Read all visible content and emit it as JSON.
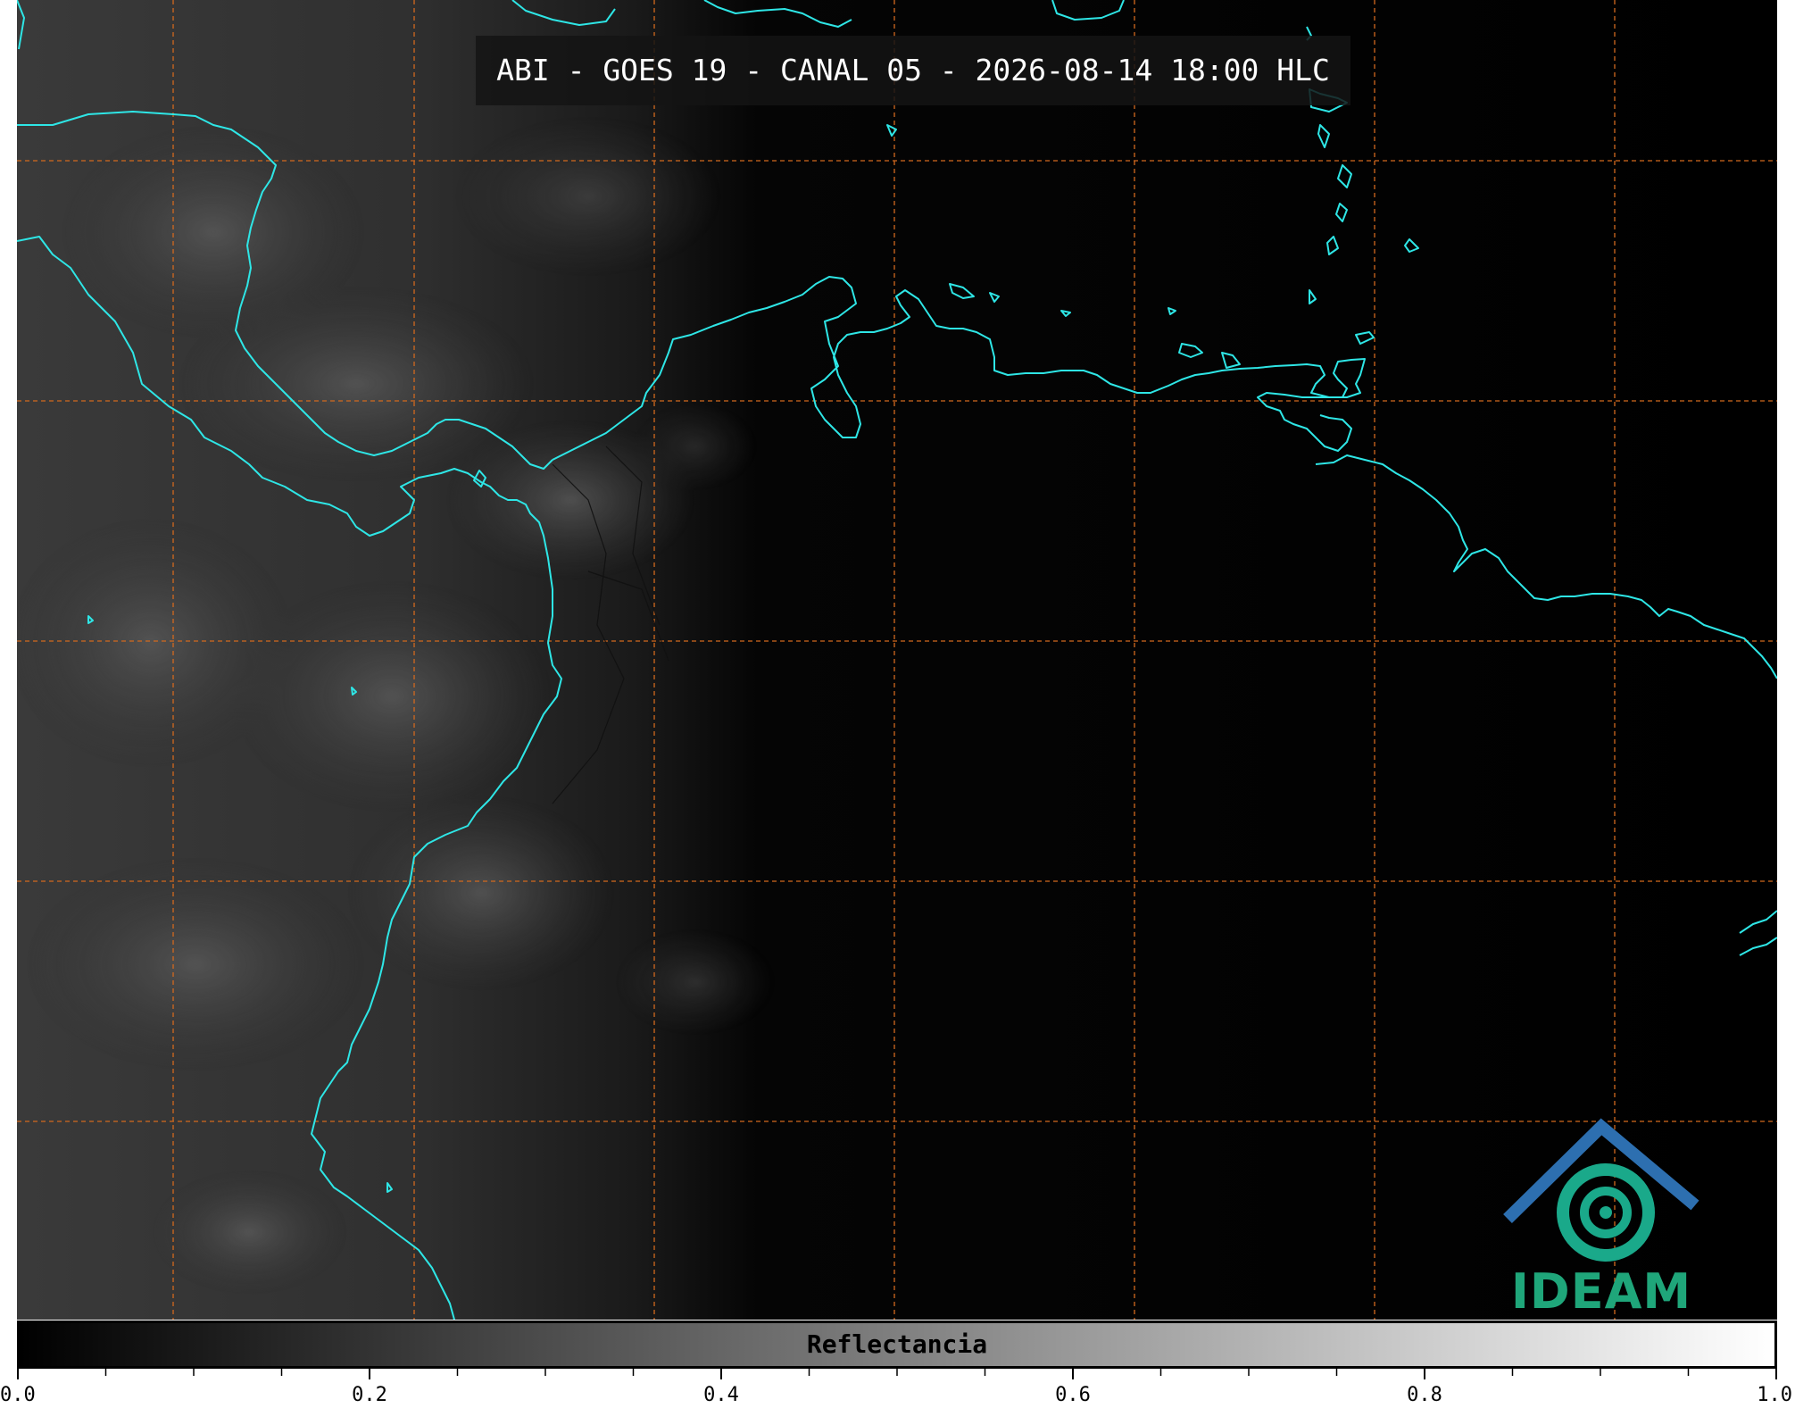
{
  "title": "ABI - GOES 19 - CANAL 05 - 2026-08-14 18:00 HLC",
  "logo": {
    "text": "IDEAM",
    "colors": {
      "roof": "#2d6fb0",
      "swirl": "#1aa98a",
      "text": "#1fa67a"
    }
  },
  "colorbar": {
    "label": "Reflectancia",
    "min": 0.0,
    "max": 1.0,
    "gradient": [
      "#000000",
      "#ffffff"
    ],
    "major_ticks": [
      "0.0",
      "0.2",
      "0.4",
      "0.6",
      "0.8",
      "1.0"
    ],
    "minor_tick_step": 0.05
  },
  "map": {
    "coastline_color": "#2ee6e6",
    "grid_color": "#d2691e",
    "grid_style": "dashed",
    "background": "#000000"
  }
}
